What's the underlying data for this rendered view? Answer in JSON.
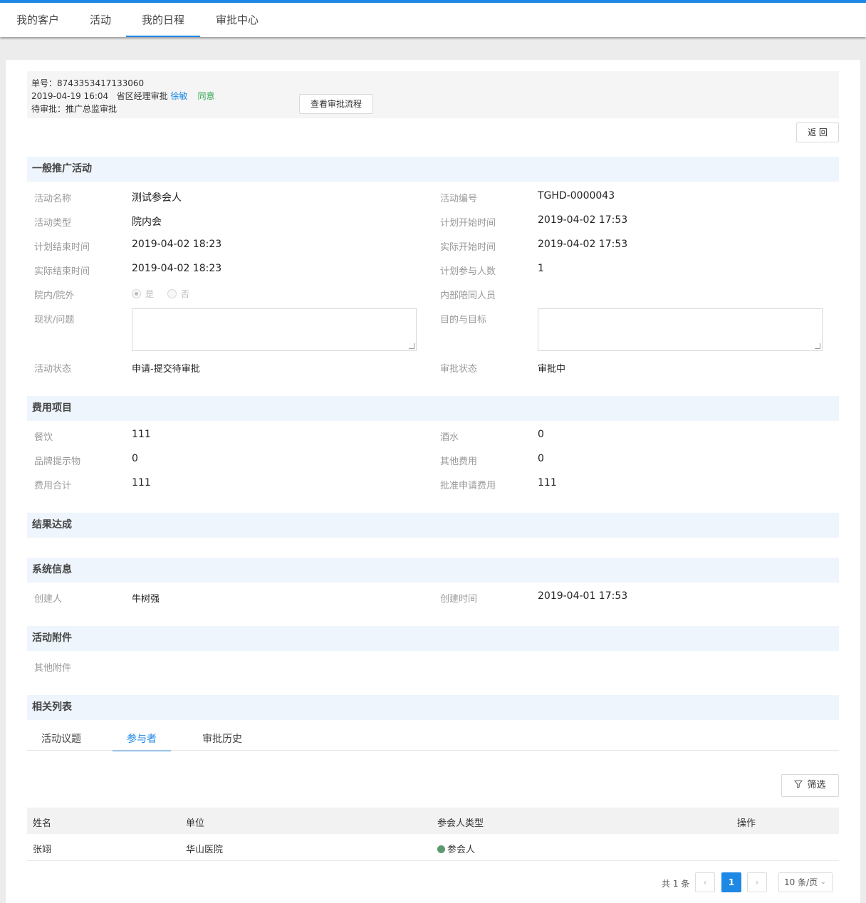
{
  "nav": {
    "tabs": [
      "我的客户",
      "活动",
      "我的日程",
      "审批中心"
    ],
    "active": "我的日程"
  },
  "approval": {
    "number_line": "单号：8743353417133060",
    "time_role": "2019-04-19 16:04   省区经理审批",
    "approver": "徐敏",
    "result": "同意",
    "pending": "待审批：推广总监审批",
    "view_flow_button": "查看审批流程"
  },
  "back_button": "返 回",
  "sections": {
    "general": "一般推广活动",
    "cost": "费用项目",
    "result": "结果达成",
    "system": "系统信息",
    "attachments": "活动附件",
    "related": "相关列表"
  },
  "general": {
    "name_label": "活动名称",
    "name": "测试参会人",
    "code_label": "活动编号",
    "code": "TGHD-0000043",
    "type_label": "活动类型",
    "type": "院内会",
    "plan_start_label": "计划开始时间",
    "plan_start": "2019-04-02 17:53",
    "plan_end_label": "计划结束时间",
    "plan_end": "2019-04-02 18:23",
    "actual_start_label": "实际开始时间",
    "actual_start": "2019-04-02 17:53",
    "actual_end_label": "实际结束时间",
    "actual_end": "2019-04-02 18:23",
    "plan_count_label": "计划参与人数",
    "plan_count": "1",
    "in_out_label": "院内/院外",
    "option_yes": "是",
    "option_no": "否",
    "accompany_label": "内部陪同人员",
    "status_quo_label": "现状/问题",
    "goal_label": "目的与目标",
    "activity_status_label": "活动状态",
    "activity_status": "申请-提交待审批",
    "approval_status_label": "审批状态",
    "approval_status": "审批中"
  },
  "cost": {
    "meal_label": "餐饮",
    "meal": "111",
    "drinks_label": "酒水",
    "drinks": "0",
    "brand_label": "品牌提示物",
    "brand": "0",
    "other_label": "其他费用",
    "other": "0",
    "total_label": "费用合计",
    "total": "111",
    "approved_label": "批准申请费用",
    "approved": "111"
  },
  "system": {
    "creator_label": "创建人",
    "creator": "牛树强",
    "created_label": "创建时间",
    "created": "2019-04-01 17:53"
  },
  "attachments": {
    "other_label": "其他附件"
  },
  "related": {
    "tabs": [
      "活动议题",
      "参与者",
      "审批历史"
    ],
    "active_tab": "参与者",
    "filter_button": "筛选",
    "columns": [
      "姓名",
      "单位",
      "参会人类型",
      "操作"
    ],
    "rows": [
      {
        "name": "张翊",
        "unit": "华山医院",
        "type": "参会人",
        "type_color": "#5a9a6e"
      }
    ]
  },
  "pagination": {
    "total": "共 1 条",
    "prev": "‹",
    "current": "1",
    "next": "›",
    "page_size": "10 条/页"
  },
  "colors": {
    "accent": "#1e88e5",
    "section_bg": "#eef5fc",
    "approved_green": "#2ea44f"
  }
}
